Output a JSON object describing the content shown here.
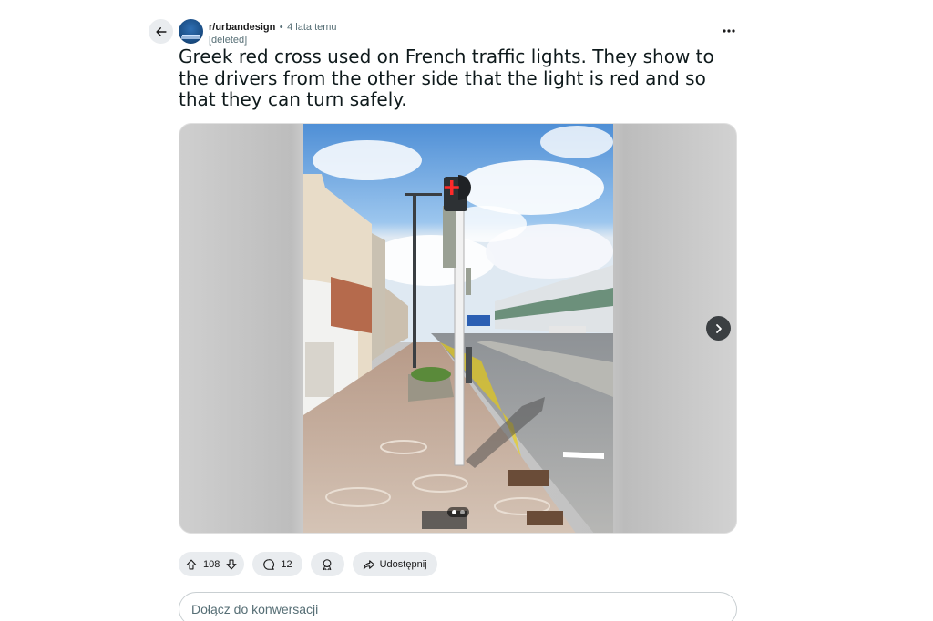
{
  "post": {
    "subreddit": "r/urbandesign",
    "separator": "•",
    "age": "4 lata temu",
    "author": "[deleted]",
    "title": "Greek red cross used on French traffic lights. They show to the drivers from the other side that the light is red and so that they can turn safely."
  },
  "icons": {
    "back": "arrow-left-icon",
    "more": "ellipsis-icon",
    "next": "chevron-right-icon",
    "upvote": "arrow-up-icon",
    "downvote": "arrow-down-icon",
    "comment": "speech-bubble-icon",
    "award": "award-icon",
    "share": "share-icon"
  },
  "gallery": {
    "current": 1,
    "total": 2
  },
  "actions": {
    "votes": "108",
    "comments": "12",
    "share_label": "Udostępnij"
  },
  "comment_box": {
    "placeholder": "Dołącz do konwersacji"
  },
  "colors": {
    "pill_bg": "#e9ecef",
    "next_btn_bg": "#3b3f42",
    "traffic_cross": "#ff2a2a"
  }
}
